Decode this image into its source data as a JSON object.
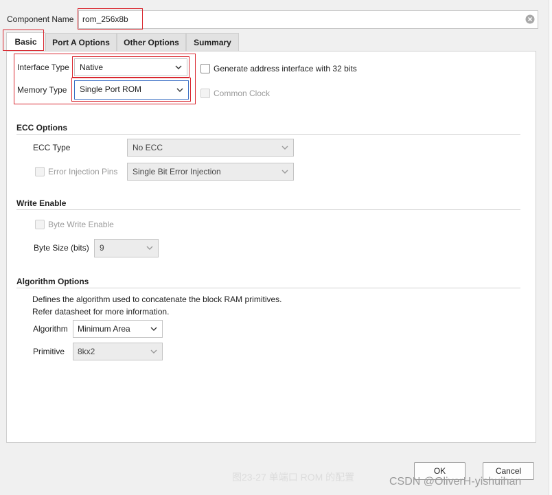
{
  "header": {
    "component_name_label": "Component Name",
    "component_name_value": "rom_256x8b"
  },
  "tabs": [
    {
      "label": "Basic",
      "active": true
    },
    {
      "label": "Port A Options",
      "active": false
    },
    {
      "label": "Other Options",
      "active": false
    },
    {
      "label": "Summary",
      "active": false
    }
  ],
  "basic": {
    "interface_type_label": "Interface Type",
    "interface_type_value": "Native",
    "memory_type_label": "Memory Type",
    "memory_type_value": "Single Port ROM",
    "generate_address_label": "Generate address interface with 32 bits",
    "common_clock_label": "Common Clock"
  },
  "ecc": {
    "section_title": "ECC Options",
    "ecc_type_label": "ECC Type",
    "ecc_type_value": "No ECC",
    "error_injection_label": "Error Injection Pins",
    "error_injection_value": "Single Bit Error Injection"
  },
  "write_enable": {
    "section_title": "Write Enable",
    "byte_write_label": "Byte Write Enable",
    "byte_size_label": "Byte Size (bits)",
    "byte_size_value": "9"
  },
  "algorithm": {
    "section_title": "Algorithm Options",
    "desc_line1": "Defines the algorithm used to concatenate the block RAM primitives.",
    "desc_line2": "Refer datasheet for more information.",
    "algorithm_label": "Algorithm",
    "algorithm_value": "Minimum Area",
    "primitive_label": "Primitive",
    "primitive_value": "8kx2"
  },
  "footer": {
    "ok_label": "OK",
    "cancel_label": "Cancel",
    "caption": "图23-27 单端口 ROM 的配置",
    "watermark": "CSDN @OliverH-yishuihan"
  },
  "colors": {
    "annotation_red": "#d9262e",
    "focus_blue": "#3a6fc4"
  }
}
